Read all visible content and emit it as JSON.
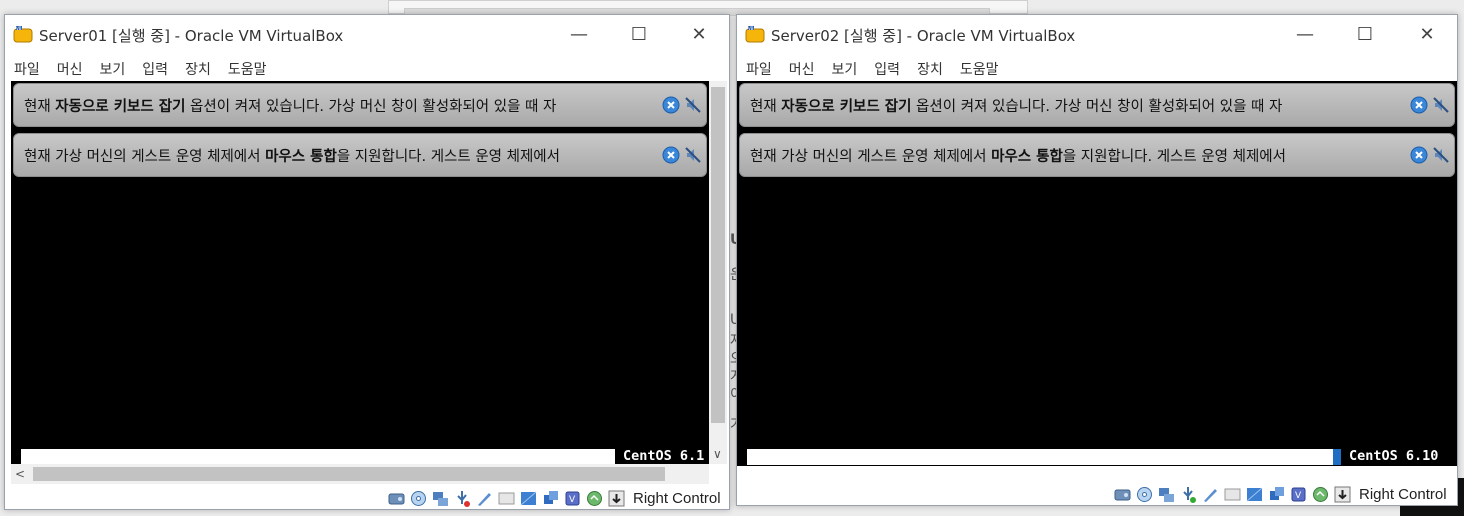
{
  "windows": [
    {
      "title": "Server01 [실행 중] - Oracle VM VirtualBox",
      "menu": [
        "파일",
        "머신",
        "보기",
        "입력",
        "장치",
        "도움말"
      ],
      "notice1": {
        "pre": "현재 ",
        "bold": "자동으로 키보드 잡기",
        "post": " 옵션이 켜져 있습니다. 가상 머신 창이 활성화되어 있을 때 자"
      },
      "notice2": {
        "pre": "현재 가상 머신의 게스트 운영 체제에서 ",
        "bold": "마우스 통합",
        "post": "을 지원합니다. 게스트 운영 체제에서"
      },
      "boot_label": "CentOS 6.1",
      "host_key": "Right Control"
    },
    {
      "title": "Server02 [실행 중] - Oracle VM VirtualBox",
      "menu": [
        "파일",
        "머신",
        "보기",
        "입력",
        "장치",
        "도움말"
      ],
      "notice1": {
        "pre": "현재 ",
        "bold": "자동으로 키보드 잡기",
        "post": " 옵션이 켜져 있습니다. 가상 머신 창이 활성화되어 있을 때 자"
      },
      "notice2": {
        "pre": "현재 가상 머신의 게스트 운영 체제에서 ",
        "bold": "마우스 통합",
        "post": "을 지원합니다. 게스트 운영 체제에서"
      },
      "boot_label": "CentOS 6.10",
      "host_key": "Right Control"
    }
  ],
  "window_controls": {
    "minimize": "—",
    "maximize": "☐",
    "close": "✕"
  },
  "background_fragments": [
    "U",
    "운",
    "U",
    "자",
    "오",
    "게",
    "이",
    "가"
  ],
  "icons": {
    "title": "virtualbox-logo-icon",
    "notice_close": "close-circle-icon",
    "notice_mute": "mute-speaker-icon",
    "status": [
      "hard-disk-icon",
      "optical-drive-icon",
      "network-icon",
      "usb-icon",
      "shared-folder-icon",
      "display-icon",
      "video-capture-icon",
      "cpu-icon",
      "mouse-integration-icon",
      "keyboard-capture-icon"
    ]
  },
  "colors": {
    "notice_bg": "#b5b5b5",
    "screen_bg": "#000000",
    "accent": "#1e6fc4"
  }
}
